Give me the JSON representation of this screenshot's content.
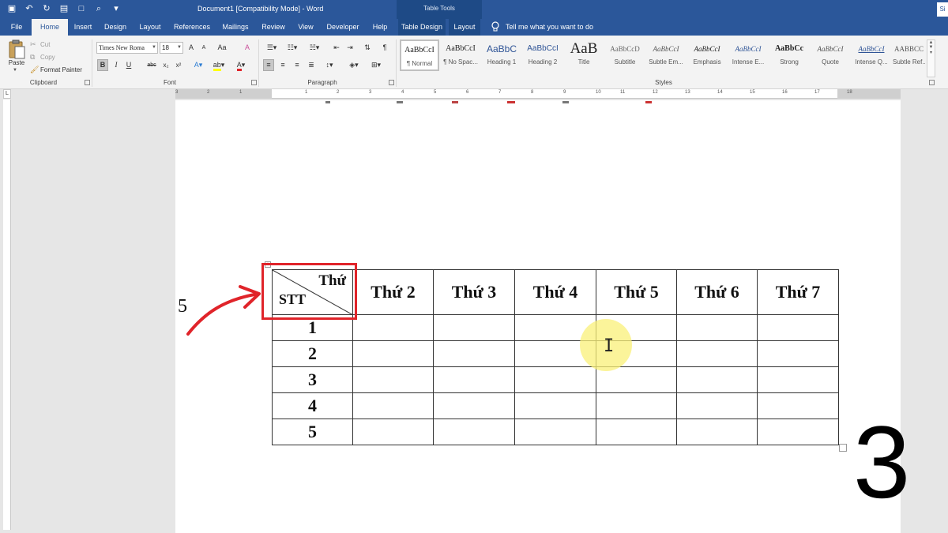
{
  "window": {
    "title": "Document1 [Compatibility Mode]  -  Word",
    "contextual_tools_label": "Table Tools",
    "user_initials": "Si"
  },
  "tabs": [
    {
      "label": "File"
    },
    {
      "label": "Home",
      "active": true
    },
    {
      "label": "Insert"
    },
    {
      "label": "Design"
    },
    {
      "label": "Layout"
    },
    {
      "label": "References"
    },
    {
      "label": "Mailings"
    },
    {
      "label": "Review"
    },
    {
      "label": "View"
    },
    {
      "label": "Developer"
    },
    {
      "label": "Help"
    },
    {
      "label": "Table Design"
    },
    {
      "label": "Layout"
    }
  ],
  "tell_me": "Tell me what you want to do",
  "clipboard": {
    "group_label": "Clipboard",
    "paste_label": "Paste",
    "cut_label": "Cut",
    "copy_label": "Copy",
    "format_painter_label": "Format Painter"
  },
  "font": {
    "group_label": "Font",
    "font_name": "Times New Roma",
    "font_size": "18",
    "bold": "B",
    "italic": "I",
    "underline": "U",
    "strikethrough": "abc",
    "subscript": "x₂",
    "superscript": "x²",
    "grow": "A",
    "shrink": "A",
    "case": "Aa",
    "clear": "A"
  },
  "paragraph": {
    "group_label": "Paragraph"
  },
  "styles": {
    "group_label": "Styles",
    "items": [
      {
        "sample": "AaBbCcI",
        "name": "¶ Normal",
        "selected": true
      },
      {
        "sample": "AaBbCcI",
        "name": "¶ No Spac..."
      },
      {
        "sample": "AaBbC",
        "name": "Heading 1"
      },
      {
        "sample": "AaBbCcI",
        "name": "Heading 2"
      },
      {
        "sample": "AaB",
        "name": "Title"
      },
      {
        "sample": "AaBbCcD",
        "name": "Subtitle"
      },
      {
        "sample": "AaBbCcI",
        "name": "Subtle Em..."
      },
      {
        "sample": "AaBbCcI",
        "name": "Emphasis"
      },
      {
        "sample": "AaBbCcI",
        "name": "Intense E..."
      },
      {
        "sample": "AaBbCc",
        "name": "Strong"
      },
      {
        "sample": "AaBbCcI",
        "name": "Quote"
      },
      {
        "sample": "AaBbCcI",
        "name": "Intense Q..."
      },
      {
        "sample": "AABBCC",
        "name": "Subtle Ref..."
      }
    ]
  },
  "ruler": {
    "numbers": [
      "3",
      "2",
      "1",
      "1",
      "2",
      "3",
      "4",
      "5",
      "6",
      "7",
      "8",
      "9",
      "10",
      "11",
      "12",
      "13",
      "14",
      "15",
      "16",
      "17",
      "18"
    ]
  },
  "table": {
    "corner_top_right": "Thứ",
    "corner_bottom_left": "STT",
    "headers": [
      "Thứ 2",
      "Thứ 3",
      "Thứ 4",
      "Thứ 5",
      "Thứ 6",
      "Thứ 7"
    ],
    "rows": [
      "1",
      "2",
      "3",
      "4",
      "5"
    ]
  },
  "annotations": {
    "step_left": "5",
    "step_right": "3",
    "highlight_color": "#e0242a"
  },
  "colors": {
    "ribbon_blue": "#2b579a",
    "ribbon_bg": "#f3f3f3",
    "highlight_yellow": "#faf078"
  }
}
